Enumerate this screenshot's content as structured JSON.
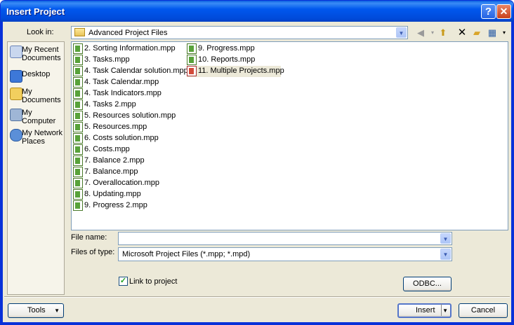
{
  "window": {
    "title": "Insert Project",
    "help_glyph": "?",
    "close_glyph": "✕"
  },
  "look_in": {
    "label": "Look in:",
    "value": "Advanced Project Files"
  },
  "toolbar": {
    "icons": [
      "back-icon",
      "up-folder-icon",
      "delete-icon",
      "new-folder-icon",
      "views-icon"
    ]
  },
  "places": [
    {
      "label": "My Recent Documents",
      "icon": "recent-documents-icon"
    },
    {
      "label": "Desktop",
      "icon": "desktop-icon"
    },
    {
      "label": "My Documents",
      "icon": "my-documents-icon"
    },
    {
      "label": "My Computer",
      "icon": "my-computer-icon"
    },
    {
      "label": "My Network Places",
      "icon": "network-places-icon"
    }
  ],
  "files_col1": [
    "2. Sorting Information.mpp",
    "3. Tasks.mpp",
    "4. Task Calendar solution.mpp",
    "4. Task Calendar.mpp",
    "4. Task Indicators.mpp",
    "4. Tasks 2.mpp",
    "5. Resources solution.mpp",
    "5. Resources.mpp",
    "6. Costs solution.mpp",
    "6. Costs.mpp",
    "7. Balance 2.mpp",
    "7. Balance.mpp",
    "7. Overallocation.mpp",
    "8. Updating.mpp",
    "9. Progress 2.mpp"
  ],
  "files_col2": [
    "9. Progress.mpp",
    "10. Reports.mpp",
    "11. Multiple Projects.mpp"
  ],
  "file_name": {
    "label": "File name:",
    "value": ""
  },
  "files_of_type": {
    "label": "Files of type:",
    "value": "Microsoft Project Files (*.mpp; *.mpd)"
  },
  "link_to_project": {
    "label": "Link to project",
    "checked": true,
    "check_glyph": "✓"
  },
  "buttons": {
    "odbc": "ODBC...",
    "tools": "Tools",
    "insert": "Insert",
    "cancel": "Cancel"
  }
}
